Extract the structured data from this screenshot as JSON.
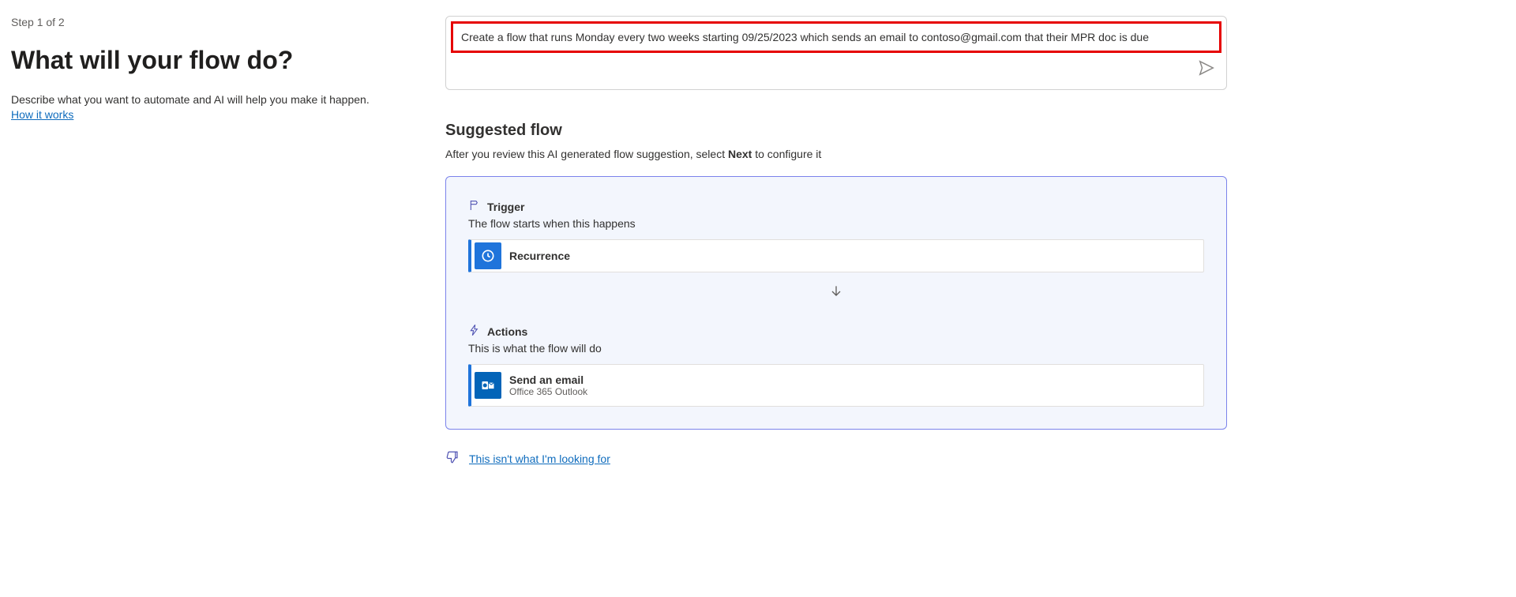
{
  "left": {
    "step": "Step 1 of 2",
    "heading": "What will your flow do?",
    "description": "Describe what you want to automate and AI will help you make it happen.",
    "howItWorks": "How it works"
  },
  "prompt": {
    "text": "Create a flow that runs Monday every two weeks starting 09/25/2023 which sends an email to contoso@gmail.com that their MPR doc is due"
  },
  "suggested": {
    "heading": "Suggested flow",
    "sub_prefix": "After you review this AI generated flow suggestion, select ",
    "sub_bold": "Next",
    "sub_suffix": " to configure it"
  },
  "trigger": {
    "label": "Trigger",
    "sub": "The flow starts when this happens",
    "step": {
      "title": "Recurrence"
    }
  },
  "actions": {
    "label": "Actions",
    "sub": "This is what the flow will do",
    "step": {
      "title": "Send an email",
      "sub": "Office 365 Outlook"
    }
  },
  "feedback": {
    "link": "This isn't what I'm looking for"
  }
}
